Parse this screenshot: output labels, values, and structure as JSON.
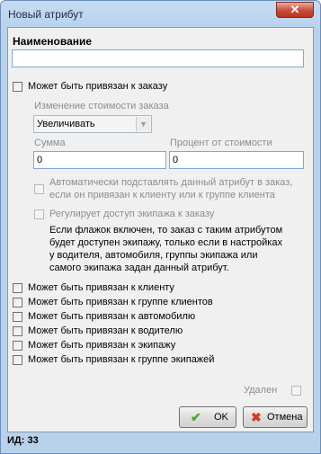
{
  "window": {
    "title": "Новый атрибут",
    "close_glyph": "✕"
  },
  "form": {
    "name_label": "Наименование",
    "name_value": "",
    "order": {
      "checkbox_label": "Может быть привязан к заказу",
      "checked": false,
      "price_change_label": "Изменение стоимости заказа",
      "price_change_selected": "Увеличивать",
      "sum_label": "Сумма",
      "sum_value": "0",
      "percent_label": "Процент от стоимости",
      "percent_value": "0",
      "auto_add_label_line1": "Автоматически подставлять данный атрибут в заказ,",
      "auto_add_label_line2": "если он привязан к клиенту или к группе клиента",
      "crew_access_label": "Регулирует доступ экипажа к заказу",
      "crew_access_note": [
        "Если флажок включен, то заказ с таким атрибутом",
        "будет доступен экипажу, только если в настройках",
        "у водителя, автомобиля, группы экипажа или",
        "самого экипажа задан данный атрибут."
      ]
    },
    "bindings": [
      {
        "label": "Может быть привязан к клиенту",
        "checked": false
      },
      {
        "label": "Может быть привязан к группе клиентов",
        "checked": false
      },
      {
        "label": "Может быть привязан к автомобилю",
        "checked": false
      },
      {
        "label": "Может быть привязан к водителю",
        "checked": false
      },
      {
        "label": "Может быть привязан к экипажу",
        "checked": false
      },
      {
        "label": "Может быть привязан к группе экипажей",
        "checked": false
      }
    ],
    "deleted_label": "Удален",
    "deleted_checked": false
  },
  "buttons": {
    "ok_label": "OK",
    "cancel_label": "Отмена"
  },
  "icons": {
    "ok": "check-icon",
    "cancel": "cross-icon"
  },
  "colors": {
    "ok_icon": "#4aa82a",
    "cancel_icon": "#d63a22"
  },
  "status": {
    "id_text": "ИД: 33"
  }
}
